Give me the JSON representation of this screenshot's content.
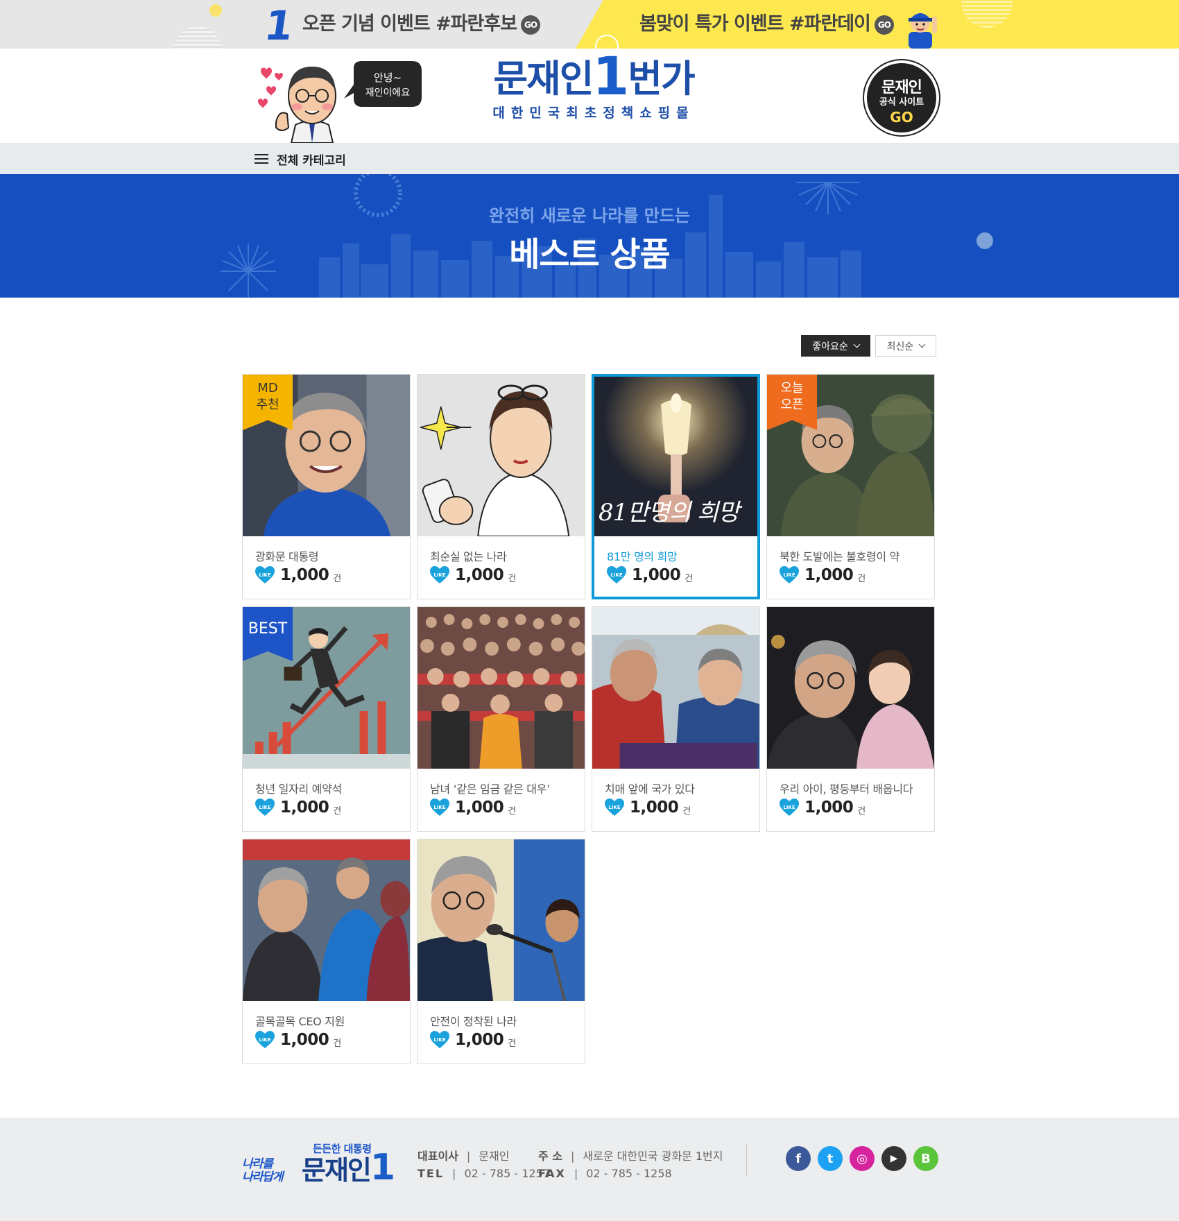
{
  "event_banner": {
    "rank": "1",
    "left_text": "오픈 기념 이벤트 #파란후보",
    "right_text": "봄맞이 특가 이벤트 #파란데이",
    "go_label": "GO"
  },
  "header": {
    "mascot_bubble": "안녕~ 재인이에요",
    "logo_name": "문재인",
    "logo_number": "1",
    "logo_suffix": "번가",
    "logo_subtitle": "대한민국최초정책쇼핑몰",
    "official_site": {
      "line1": "문재인",
      "line2": "공식 사이트",
      "line3": "GO"
    }
  },
  "category": {
    "label": "전체 카테고리"
  },
  "hero": {
    "subtitle": "완전히 새로운 나라를 만드는",
    "title": "베스트 상품"
  },
  "sort": {
    "options": [
      {
        "label": "좋아요순",
        "active": true
      },
      {
        "label": "최신순",
        "active": false
      }
    ]
  },
  "products": [
    {
      "name": "광화문 대통령",
      "likes": "1,000",
      "unit": "건",
      "badge": "MD\n추천",
      "badge_type": "md",
      "image": "portrait-blue-scarf"
    },
    {
      "name": "최순실 없는 나라",
      "likes": "1,000",
      "unit": "건",
      "badge": "",
      "badge_type": "",
      "image": "cartoon-woman-phone"
    },
    {
      "name": "81만 명의 희망",
      "likes": "1,000",
      "unit": "건",
      "badge": "",
      "badge_type": "",
      "image": "candle-81man",
      "image_caption": "81만명의 희망",
      "selected": true
    },
    {
      "name": "북한 도발에는 불호령이 약",
      "likes": "1,000",
      "unit": "건",
      "badge": "오늘\n오픈",
      "badge_type": "today",
      "image": "soldiers"
    },
    {
      "name": "청년 일자리 예약석",
      "likes": "1,000",
      "unit": "건",
      "badge": "BEST",
      "badge_type": "best",
      "image": "jumping-businessman"
    },
    {
      "name": "남녀 ‘같은 임금 같은 대우’",
      "likes": "1,000",
      "unit": "건",
      "badge": "",
      "badge_type": "",
      "image": "crowd-auditorium"
    },
    {
      "name": "치매 앞에 국가 있다",
      "likes": "1,000",
      "unit": "건",
      "badge": "",
      "badge_type": "",
      "image": "elderly-bus"
    },
    {
      "name": "우리 아이, 평등부터 배웁니다",
      "likes": "1,000",
      "unit": "건",
      "badge": "",
      "badge_type": "",
      "image": "holding-child"
    },
    {
      "name": "골목골목 CEO 지원",
      "likes": "1,000",
      "unit": "건",
      "badge": "",
      "badge_type": "",
      "image": "market-handshake"
    },
    {
      "name": "안전이 정착된 나라",
      "likes": "1,000",
      "unit": "건",
      "badge": "",
      "badge_type": "",
      "image": "speech-microphone"
    }
  ],
  "like_icon_label": "LIKE",
  "footer": {
    "slogan": "나라를\n나라답게",
    "logo_small": "든든한 대통령",
    "logo_name": "문재인",
    "logo_number": "1",
    "ceo_label": "대표이사",
    "ceo_value": "문재인",
    "tel_label": "TEL",
    "tel_value": "02 - 785 - 1257",
    "addr_label": "주 소",
    "addr_value": "새로운 대한민국 광화문 1번지",
    "fax_label": "FAX",
    "fax_value": "02 - 785 - 1258",
    "social": [
      {
        "name": "facebook-icon",
        "glyph": "f",
        "color": "#3b5998"
      },
      {
        "name": "twitter-icon",
        "glyph": "t",
        "color": "#1da1f2"
      },
      {
        "name": "instagram-icon",
        "glyph": "◎",
        "color": "#d6249f"
      },
      {
        "name": "youtube-icon",
        "glyph": "▶",
        "color": "#333333"
      },
      {
        "name": "blog-icon",
        "glyph": "B",
        "color": "#5ac43a"
      }
    ]
  },
  "colors": {
    "primary": "#1650c0",
    "selected_border": "#0d9ad6",
    "like_heart": "#19a2dc",
    "event_yellow": "#fde84f"
  }
}
